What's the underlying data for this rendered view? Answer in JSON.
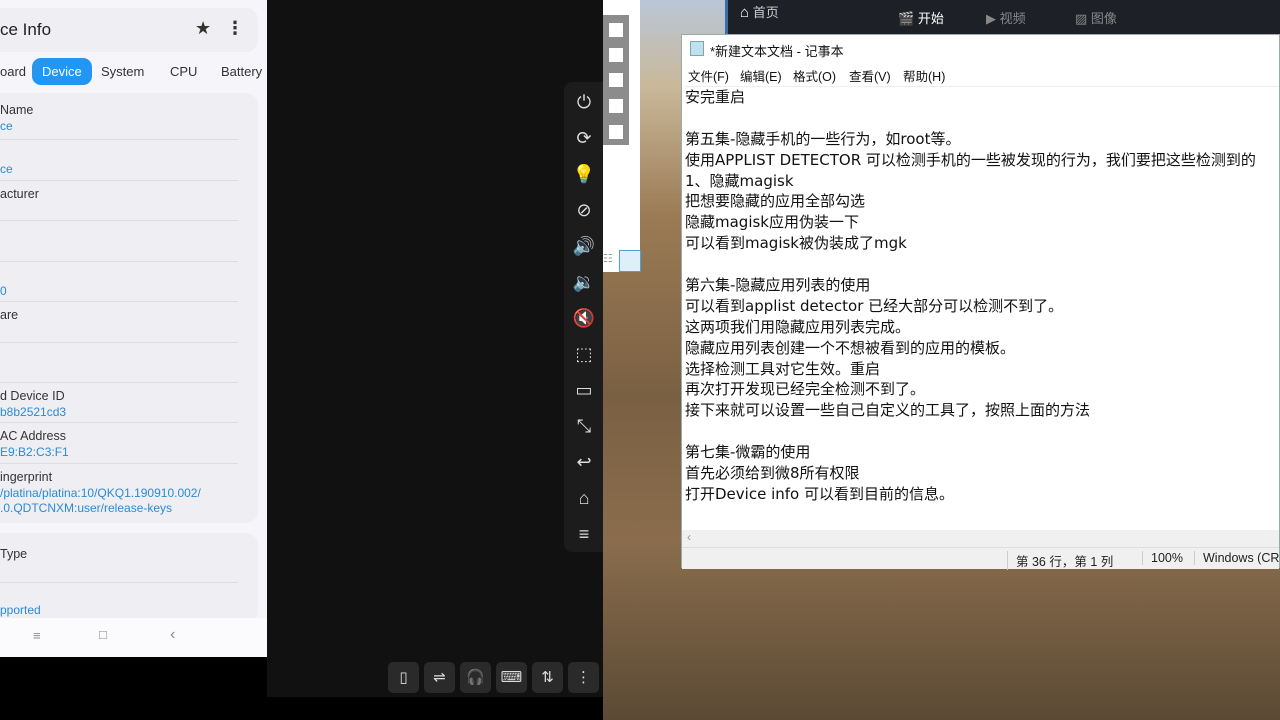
{
  "phone": {
    "title": "ce Info",
    "tabs": [
      {
        "label": "oard"
      },
      {
        "label": "Device",
        "active": true
      },
      {
        "label": "System"
      },
      {
        "label": "CPU"
      },
      {
        "label": "Battery"
      }
    ],
    "rows": [
      {
        "label": " Name",
        "value": "ce"
      },
      {
        "label": "",
        "value": "ce"
      },
      {
        "label": "acturer",
        "value": ""
      },
      {
        "label": "",
        "value": ""
      },
      {
        "label": "",
        "value": "0"
      },
      {
        "label": "are",
        "value": ""
      },
      {
        "label": "",
        "value": ""
      },
      {
        "label": "d Device ID",
        "value": "b8b2521cd3"
      },
      {
        "label": "AC Address",
        "value": "E9:B2:C3:F1"
      },
      {
        "label": "ingerprint",
        "value": "/platina/platina:10/QKQ1.190910.002/\n.0.QDTCNXM:user/release-keys"
      }
    ],
    "card2": [
      {
        "label": " Type",
        "value": ""
      },
      {
        "label": "",
        "value": "pported"
      }
    ],
    "nav": {
      "menu": "≡",
      "home": "□",
      "back": "‹"
    }
  },
  "sidetool_icons": [
    "power-icon",
    "rotate-icon",
    "bulb-icon",
    "bulb-off-icon",
    "volume-up-icon",
    "volume-down-icon",
    "mute-icon",
    "screenshot-icon",
    "record-icon",
    "resize-icon",
    "back-icon",
    "home-icon",
    "menu-icon"
  ],
  "bottool_icons": [
    "window-icon",
    "usb-icon",
    "headset-icon",
    "keyboard-icon",
    "transfer-icon",
    "more-icon"
  ],
  "video_app": {
    "home": "首页",
    "tabs": [
      "开始",
      "视频",
      "图像"
    ]
  },
  "notepad": {
    "title": "*新建文本文档 - 记事本",
    "menus": [
      "文件(F)",
      "编辑(E)",
      "格式(O)",
      "查看(V)",
      "帮助(H)"
    ],
    "lines": [
      "安完重启",
      "",
      "第五集-隐藏手机的一些行为，如root等。",
      "使用APPLIST DETECTOR 可以检测手机的一些被发现的行为，我们要把这些检测到的",
      "1、隐藏magisk",
      "把想要隐藏的应用全部勾选",
      "隐藏magisk应用伪装一下",
      "可以看到magisk被伪装成了mgk",
      "",
      "第六集-隐藏应用列表的使用",
      "可以看到applist detector 已经大部分可以检测不到了。",
      "这两项我们用隐藏应用列表完成。",
      "隐藏应用列表创建一个不想被看到的应用的模板。",
      "选择检测工具对它生效。重启",
      "再次打开发现已经完全检测不到了。",
      "接下来就可以设置一些自己自定义的工具了，按照上面的方法",
      "",
      "第七集-微霸的使用",
      "首先必须给到微8所有权限",
      "打开Device info 可以看到目前的信息。"
    ],
    "status": {
      "position": "第 36 行，第 1 列",
      "zoom": "100%",
      "encoding": "Windows (CRLF)"
    }
  },
  "colors": {
    "accent": "#2196f3",
    "value": "#2a8bd6"
  }
}
